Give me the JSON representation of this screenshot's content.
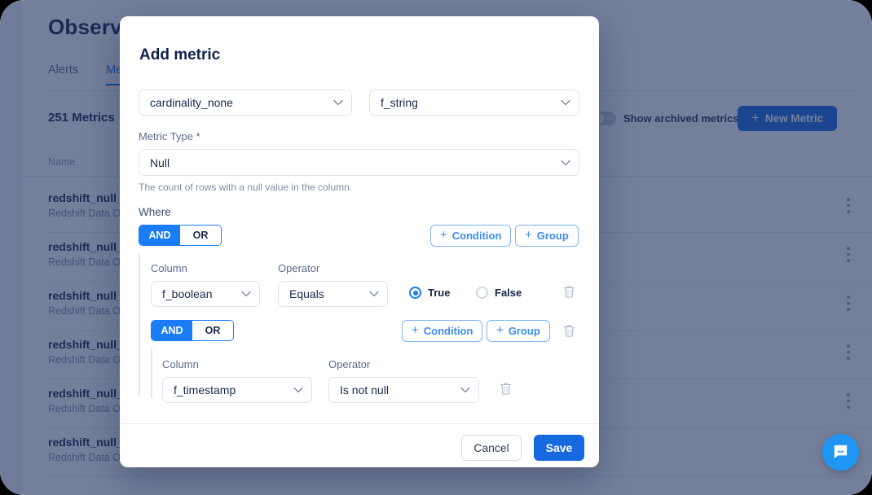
{
  "page": {
    "title": "Observability",
    "tabs": [
      {
        "label": "Alerts",
        "active": false
      },
      {
        "label": "Metrics",
        "active": true
      }
    ],
    "metrics_count": "251 Metrics",
    "archived_label": "Show archived metrics",
    "new_metric_label": "New Metric",
    "new_metric_plus": "+",
    "list_header": "Name",
    "rows": [
      {
        "name": "redshift_null_",
        "sub": "Redshift Data Ob"
      },
      {
        "name": "redshift_null_",
        "sub": "Redshift Data Ob"
      },
      {
        "name": "redshift_null_",
        "sub": "Redshift Data Ob"
      },
      {
        "name": "redshift_null_",
        "sub": "Redshift Data Ob"
      },
      {
        "name": "redshift_null_",
        "sub": "Redshift Data Ob"
      },
      {
        "name": "redshift_null_",
        "sub": "Redshift Data Ob"
      }
    ]
  },
  "modal": {
    "title": "Add metric",
    "close_icon": "close-icon",
    "dataset_select": {
      "value": "cardinality_none"
    },
    "column_select": {
      "value": "f_string"
    },
    "metric_type": {
      "label": "Metric Type *",
      "value": "Null",
      "help": "The count of rows with a null value in the column."
    },
    "where": {
      "label": "Where",
      "root": {
        "operator_and": "AND",
        "operator_or": "OR",
        "selected": "AND",
        "add_condition_label": "Condition",
        "add_group_label": "Group",
        "plus": "+"
      },
      "condition": {
        "column_label": "Column",
        "column_value": "f_boolean",
        "operator_label": "Operator",
        "operator_value": "Equals",
        "true_label": "True",
        "false_label": "False",
        "value_selected": "True"
      },
      "group": {
        "operator_and": "AND",
        "operator_or": "OR",
        "selected": "AND",
        "add_condition_label": "Condition",
        "add_group_label": "Group",
        "plus": "+",
        "condition": {
          "column_label": "Column",
          "column_value": "f_timestamp",
          "operator_label": "Operator",
          "operator_value": "Is not null"
        }
      }
    },
    "footer": {
      "cancel_label": "Cancel",
      "save_label": "Save"
    }
  },
  "chat": {
    "icon": "chat-bubble-icon"
  },
  "colors": {
    "accent": "#1769e0",
    "toggle_blue": "#1a7cf7",
    "link_blue": "#3d8bf8",
    "overlay": "#1f305e",
    "text_dark": "#10214b",
    "chat": "#1f96f3"
  }
}
